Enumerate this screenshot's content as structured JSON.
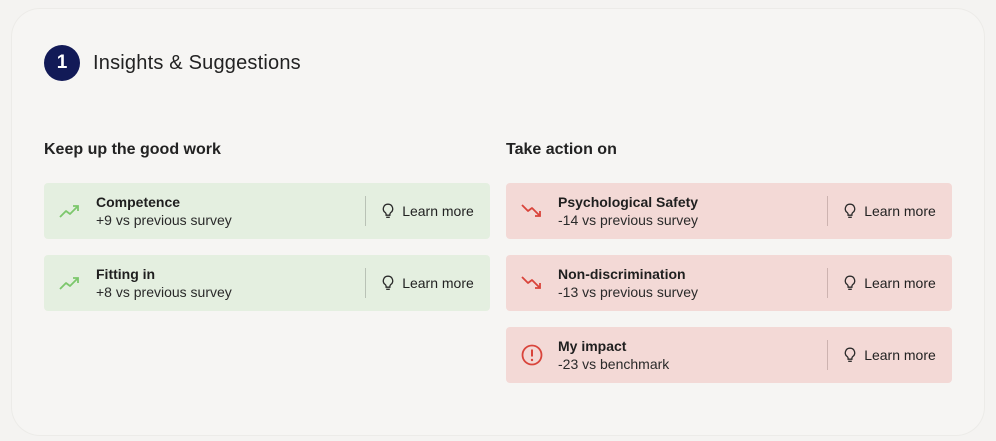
{
  "header": {
    "step": "1",
    "title": "Insights & Suggestions"
  },
  "strengths": {
    "heading": "Keep up the good work",
    "items": [
      {
        "name": "Competence",
        "delta": "+9 vs previous survey",
        "icon": "trend-up-icon",
        "link": "Learn more"
      },
      {
        "name": "Fitting in",
        "delta": "+8 vs previous survey",
        "icon": "trend-up-icon",
        "link": "Learn more"
      }
    ]
  },
  "actions": {
    "heading": "Take action on",
    "items": [
      {
        "name": "Psychological Safety",
        "delta": "-14 vs previous survey",
        "icon": "trend-down-icon",
        "link": "Learn more"
      },
      {
        "name": "Non-discrimination",
        "delta": "-13 vs previous survey",
        "icon": "trend-down-icon",
        "link": "Learn more"
      },
      {
        "name": "My impact",
        "delta": "-23 vs benchmark",
        "icon": "alert-circle-icon",
        "link": "Learn more"
      }
    ]
  },
  "colors": {
    "badge": "#121a57",
    "good_bg": "#e4efe0",
    "bad_bg": "#f3d9d6",
    "trend_up": "#7cc76c",
    "trend_down": "#d9443b"
  }
}
